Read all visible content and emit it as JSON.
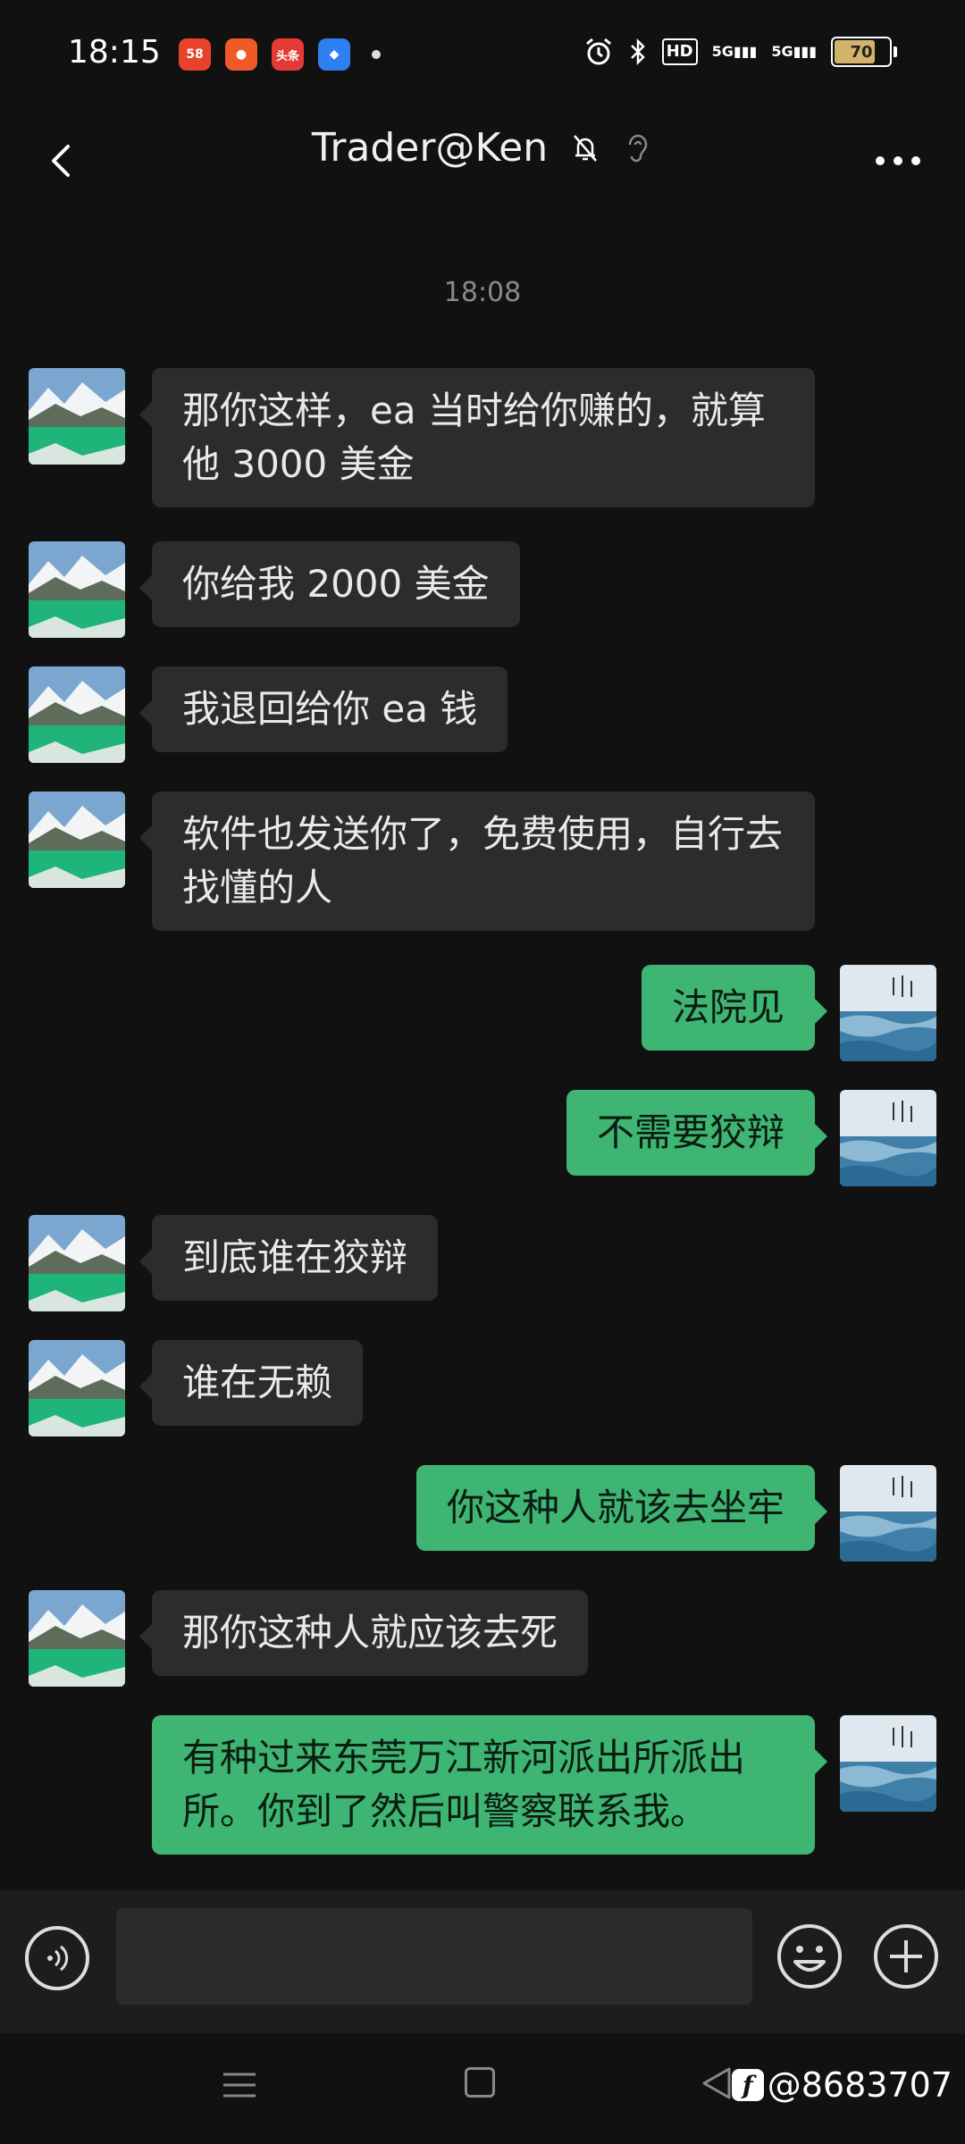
{
  "status_bar": {
    "time": "18:15",
    "app_badges": [
      "58",
      "头条"
    ],
    "battery": "70",
    "network": [
      "5G",
      "5G"
    ],
    "hd_label": "HD"
  },
  "header": {
    "title": "Trader@Ken",
    "icons": [
      "mute-bell-icon",
      "ear-icon"
    ]
  },
  "timestamp": "18:08",
  "messages": [
    {
      "side": "in",
      "text": "那你这样，ea 当时给你赚的，就算他 3000 美金"
    },
    {
      "side": "in",
      "text": "你给我 2000 美金"
    },
    {
      "side": "in",
      "text": "我退回给你 ea 钱"
    },
    {
      "side": "in",
      "text": "软件也发送你了，免费使用，自行去找懂的人"
    },
    {
      "side": "out",
      "text": "法院见"
    },
    {
      "side": "out",
      "text": "不需要狡辩"
    },
    {
      "side": "in",
      "text": "到底谁在狡辩"
    },
    {
      "side": "in",
      "text": "谁在无赖"
    },
    {
      "side": "out",
      "text": "你这种人就该去坐牢"
    },
    {
      "side": "in",
      "text": "那你这种人就应该去死"
    },
    {
      "side": "out",
      "text": "有种过来东莞万江新河派出所派出所。你到了然后叫警察联系我。"
    }
  ],
  "input": {
    "value": "",
    "placeholder": ""
  },
  "watermark": {
    "logo": "f",
    "text": "@8683707"
  },
  "colors": {
    "background": "#111111",
    "incoming_bubble": "#2c2c2c",
    "outgoing_bubble": "#3eb573"
  }
}
